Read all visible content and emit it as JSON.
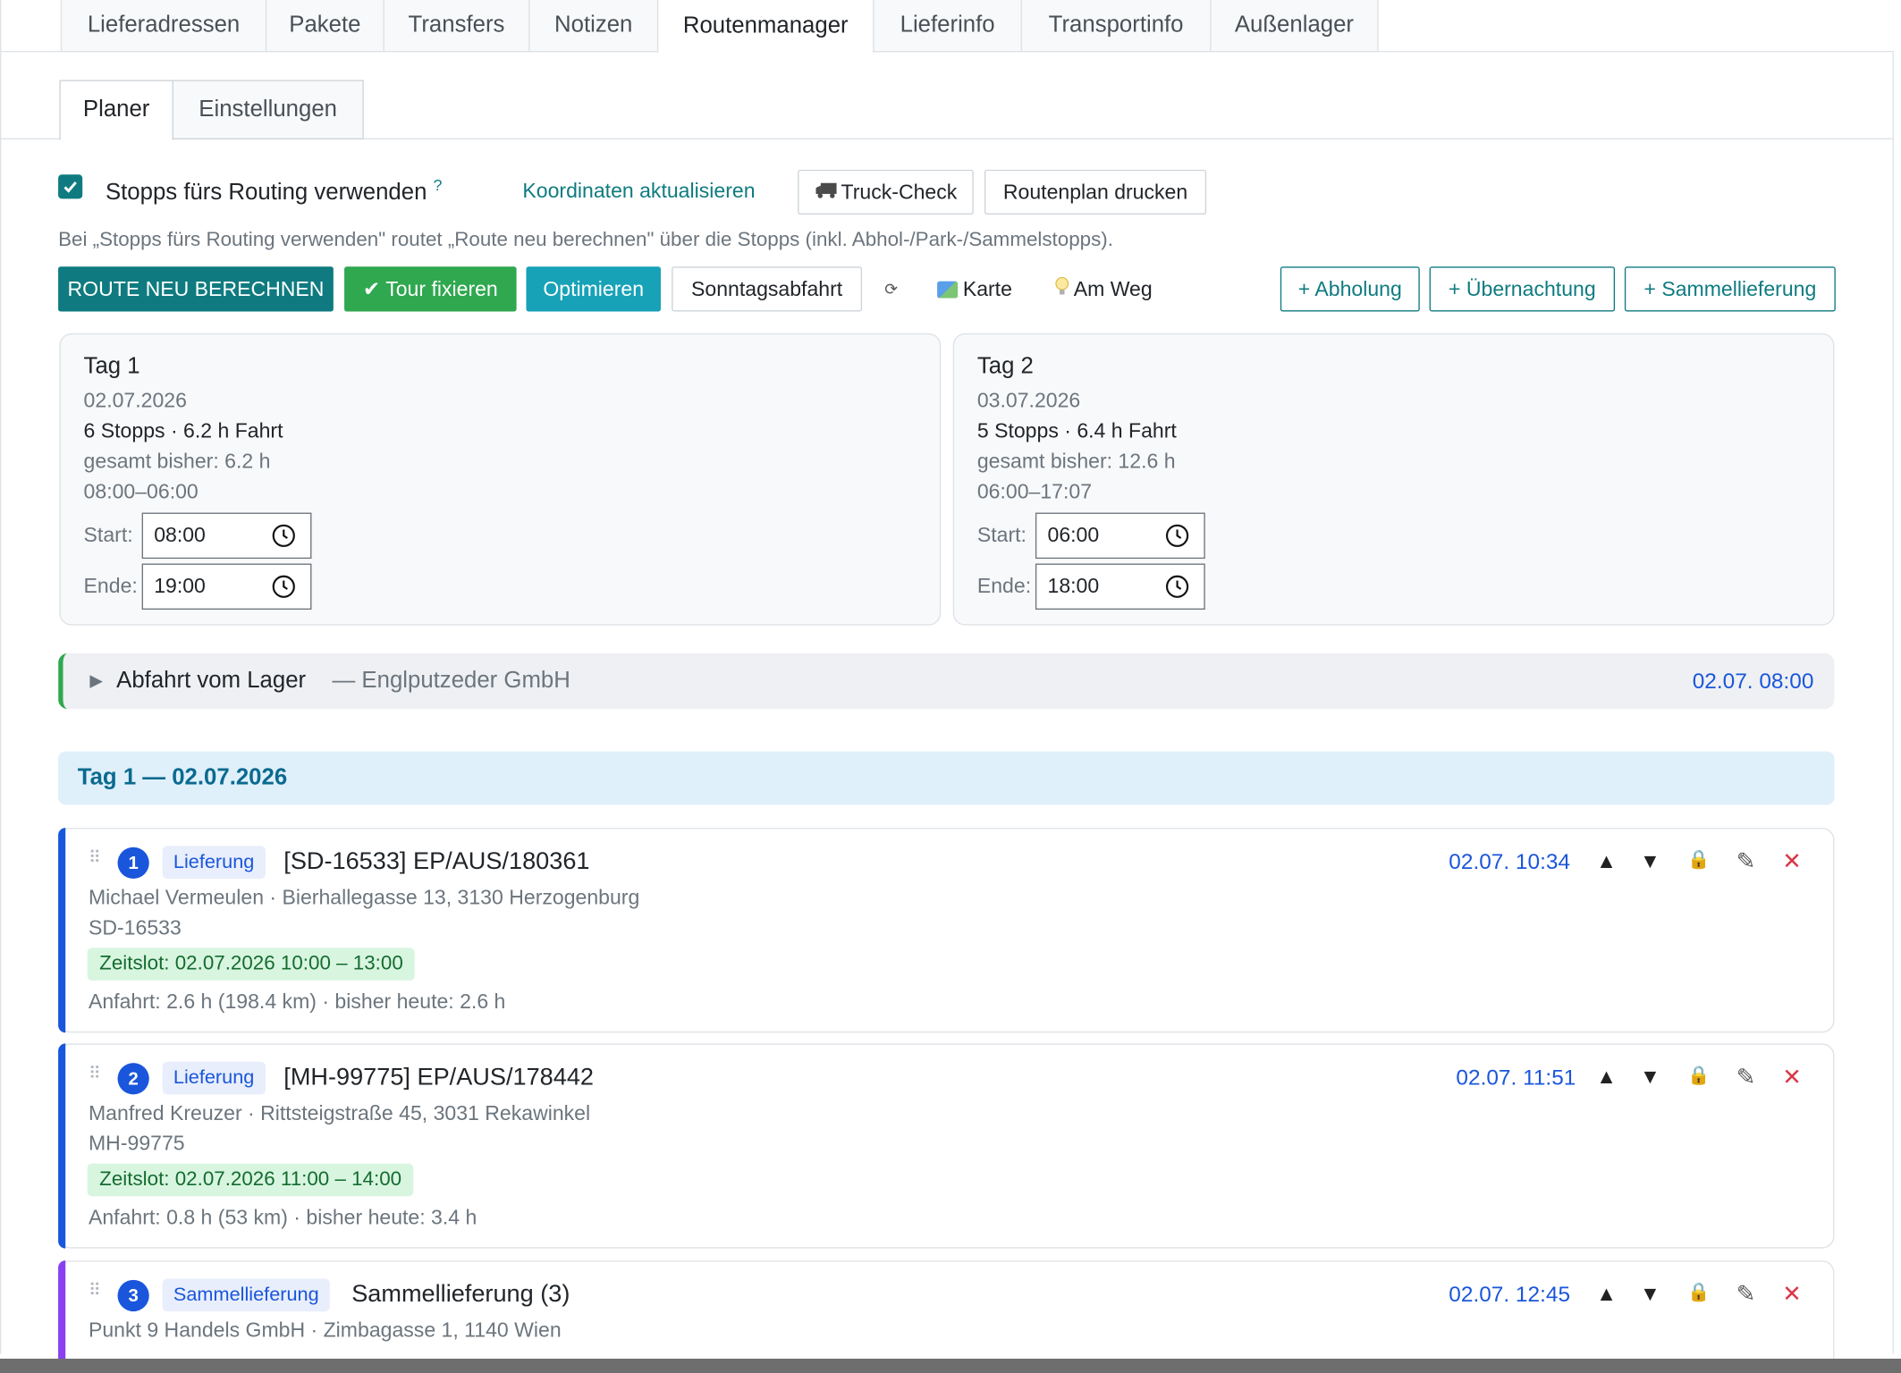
{
  "top_tabs": [
    "Lieferadressen",
    "Pakete",
    "Transfers",
    "Notizen",
    "Routenmanager",
    "Lieferinfo",
    "Transportinfo",
    "Außenlager"
  ],
  "sub_tabs": [
    "Planer",
    "Einstellungen"
  ],
  "routing": {
    "checkbox_label": "Stopps fürs Routing verwenden",
    "help_mark": "?",
    "update_coords_link": "Koordinaten aktualisieren",
    "truck_check_label": "Truck-Check",
    "print_label": "Routenplan drucken",
    "hint": "Bei „Stopps fürs Routing verwenden\" routet „Route neu berechnen\" über die Stopps (inkl. Abhol-/Park-/Sammelstopps)."
  },
  "toolbar": {
    "recalc": "ROUTE NEU BERECHNEN",
    "fix_tour": "✔ Tour fixieren",
    "optimize": "Optimieren",
    "sunday": "Sonntagsabfahrt",
    "refresh_glyph": "⟳",
    "map": "Karte",
    "on_the_way": "Am Weg",
    "add_pickup": "+ Abholung",
    "add_overnight": "+ Übernachtung",
    "add_collective": "+ Sammellieferung"
  },
  "days": [
    {
      "title": "Tag 1",
      "date": "02.07.2026",
      "summary": "6 Stopps · 6.2 h Fahrt",
      "total": "gesamt bisher: 6.2 h",
      "window": "08:00–06:00",
      "start_label": "Start:",
      "start": "08:00",
      "end_label": "Ende:",
      "end": "19:00"
    },
    {
      "title": "Tag 2",
      "date": "03.07.2026",
      "summary": "5 Stopps · 6.4 h Fahrt",
      "total": "gesamt bisher: 12.6 h",
      "window": "06:00–17:07",
      "start_label": "Start:",
      "start": "06:00",
      "end_label": "Ende:",
      "end": "18:00"
    }
  ],
  "depot": {
    "label": "Abfahrt vom Lager",
    "company": "— Englputzeder GmbH",
    "time": "02.07. 08:00"
  },
  "day_header": "Tag 1 — 02.07.2026",
  "stops": [
    {
      "num": "1",
      "type": "Lieferung",
      "title": "[SD-16533] EP/AUS/180361",
      "address": "Michael Vermeulen · Bierhallegasse 13, 3130 Herzogenburg",
      "ref": "SD-16533",
      "slot": "Zeitslot: 02.07.2026 10:00 – 13:00",
      "drive": "Anfahrt: 2.6 h (198.4 km) · bisher heute: 2.6 h",
      "eta": "02.07. 10:34",
      "color": "#1a56db"
    },
    {
      "num": "2",
      "type": "Lieferung",
      "title": "[MH-99775] EP/AUS/178442",
      "address": "Manfred Kreuzer · Rittsteigstraße 45, 3031 Rekawinkel",
      "ref": "MH-99775",
      "slot": "Zeitslot: 02.07.2026 11:00 – 14:00",
      "drive": "Anfahrt: 0.8 h (53 km) · bisher heute: 3.4 h",
      "eta": "02.07. 11:51",
      "color": "#1a56db"
    },
    {
      "num": "3",
      "type": "Sammellieferung",
      "title": "Sammellieferung (3)",
      "address": "Punkt 9 Handels GmbH · Zimbagasse 1, 1140 Wien",
      "eta": "02.07. 12:45",
      "color": "#8a3ff0"
    }
  ],
  "actions": {
    "up": "▲",
    "down": "▼",
    "lock": "🔒",
    "edit": "✎",
    "remove": "✕"
  }
}
